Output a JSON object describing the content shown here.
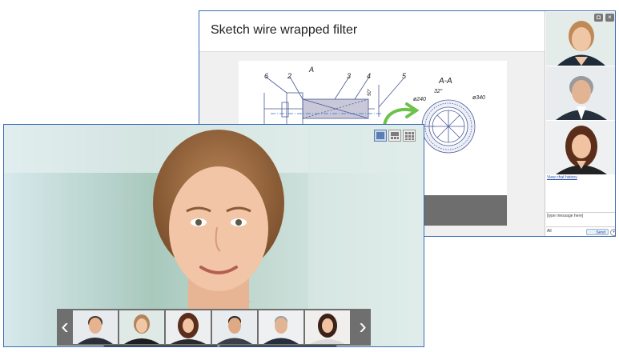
{
  "whiteboard": {
    "title": "Sketch wire wrapped filter",
    "drawing_labels": {
      "callouts": [
        "6",
        "2",
        "3",
        "4",
        "5"
      ],
      "section_mark": "A",
      "section_title": "A-A",
      "dim_angle_1": "50°",
      "dim_angle_2": "32°",
      "dim_d240": "ø240",
      "dim_d340": "ø340"
    }
  },
  "sidebar": {
    "participants": [
      {
        "name": "participant-woman-blonde"
      },
      {
        "name": "participant-man-grey-hair"
      },
      {
        "name": "participant-woman-brunette"
      }
    ],
    "chat_history_link": "View chat history",
    "chat_placeholder": "[type message here]",
    "recipient": "All",
    "send_label": "Send"
  },
  "video": {
    "layout_options": [
      "single-view-icon",
      "split-view-icon",
      "grid-view-icon"
    ],
    "active_layout": 0,
    "filmstrip": [
      {
        "name": "man-smiling"
      },
      {
        "name": "woman-blonde"
      },
      {
        "name": "woman-brunette"
      },
      {
        "name": "man-dark-hair"
      },
      {
        "name": "man-grey-hair"
      },
      {
        "name": "woman-dark-hair"
      }
    ],
    "prev_glyph": "‹",
    "next_glyph": "›"
  },
  "colors": {
    "window_border": "#3b6db5",
    "link": "#2a4ea8",
    "filmstrip_bg": "#6f6f6f"
  }
}
